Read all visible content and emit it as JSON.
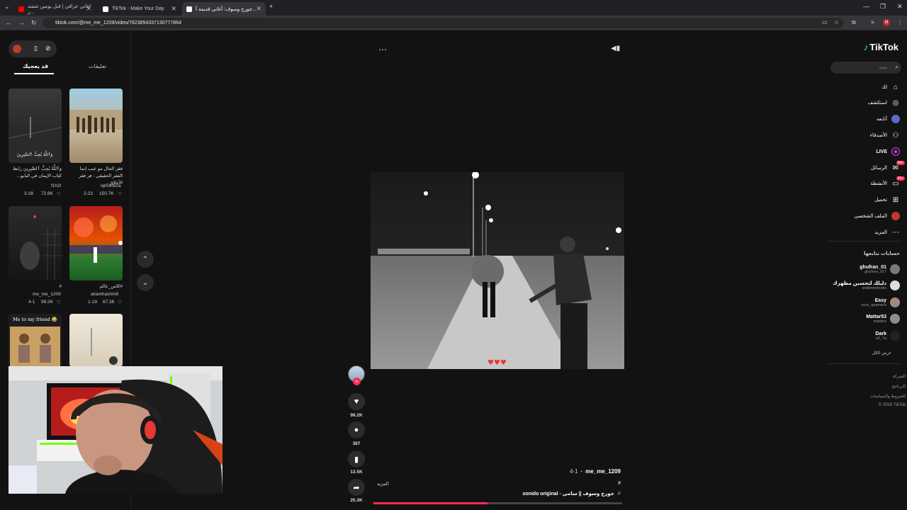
{
  "browser": {
    "tabs": [
      {
        "title": "اغاني عراقي | قبل يومين شفته ر...",
        "favicon": "#ff0000",
        "active": false
      },
      {
        "title": "TikTok - Make Your Day",
        "favicon": "#ffffff",
        "active": false
      },
      {
        "title": "جورج وسوف: أغاني قديمة أ...",
        "favicon": "#ffffff",
        "active": true
      }
    ],
    "new_tab_label": "+",
    "url": "tiktok.com/@me_me_1209/video/7623854337130777864"
  },
  "left_panel": {
    "tab_liked": "قد يعجبك",
    "tab_comments": "تعليقات",
    "videos": [
      {
        "caption": "وَٱللَّهُ يُحِبُّ ٱلصَّٰبِرِينَ رابط كتاب الإيمان في البايو...",
        "author": "f1h2l",
        "date": "3-28",
        "likes": "72.6K"
      },
      {
        "caption": "فقر الحال مو عيب إنما الفقر الحقيقي - فر فقر الأخلاق...",
        "author": "iqmorteza",
        "date": "2-23",
        "likes": "150.7K"
      },
      {
        "caption": "#",
        "author": "me_me_1209",
        "date": "4-1",
        "likes": "99.2K"
      },
      {
        "caption": "#كاس_عالم",
        "author": "akamhashm8",
        "date": "1-19",
        "likes": "67.3K"
      },
      {
        "caption": "Me to my friend 😂",
        "author": "",
        "date": "",
        "likes": ""
      }
    ]
  },
  "video": {
    "author": "me_me_1209",
    "date": "4-1",
    "desc": "#",
    "more_label": "المزيد",
    "sound": "sonido original - جورج وسوف || سامي",
    "likes": "99.2K",
    "comments": "387",
    "saves": "13.5K",
    "shares": "25.3K",
    "progress": 0.46
  },
  "right_nav": {
    "logo": "TikTok",
    "search_placeholder": "بحث",
    "items": [
      {
        "label": "لك",
        "icon": "home-icon"
      },
      {
        "label": "استكشف",
        "icon": "compass-icon"
      },
      {
        "label": "أتابعه",
        "icon": "following-icon"
      },
      {
        "label": "الأصدقاء",
        "icon": "friends-icon"
      },
      {
        "label": "LIVE",
        "icon": "live-icon"
      },
      {
        "label": "الرسائل",
        "icon": "messages-icon",
        "badge": "99+"
      },
      {
        "label": "الأنشطة",
        "icon": "activity-icon",
        "badge": "99+"
      },
      {
        "label": "تحميل",
        "icon": "upload-icon"
      },
      {
        "label": "الملف الشخصي",
        "icon": "profile-icon"
      },
      {
        "label": "المزيد",
        "icon": "more-icon"
      }
    ],
    "following_title": "حسابات تتابعها",
    "following": [
      {
        "name": "ghufran_01",
        "handle": "ghufran_017"
      },
      {
        "name": "دليلك لتحسين مظهرك",
        "handle": "arabmenlooks"
      },
      {
        "name": "Easy",
        "handle": "noor_qaqmera"
      },
      {
        "name": "Mattar53",
        "handle": "mattarx"
      },
      {
        "name": "Dark",
        "handle": "o3_7q"
      }
    ],
    "see_all": "عرض الكل",
    "footer": [
      "الشركة",
      "البرنامج",
      "الشروط والسياسات",
      "© 2026 TikTok"
    ]
  }
}
